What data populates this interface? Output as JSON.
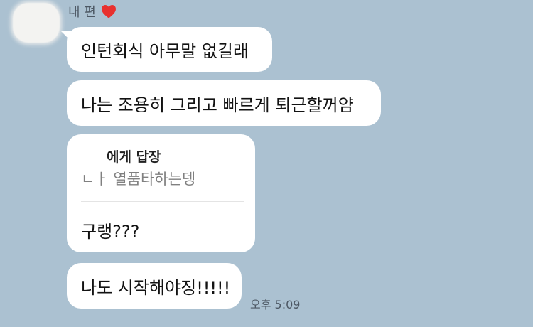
{
  "sender": {
    "name": "내 편",
    "badge_icon": "heart-icon",
    "badge_color": "#e8312f"
  },
  "messages": [
    {
      "text": "인턴회식 아무말 없길래"
    },
    {
      "text": "나는 조용히 그리고 빠르게 퇴근할꺼얌"
    },
    {
      "reply": {
        "to": "에게 답장",
        "quote": "ㄴㅏ 열품타하는뎅"
      },
      "text": "구랭???"
    },
    {
      "text": "나도 시작해야징!!!!!"
    }
  ],
  "timestamp": "오후 5:09",
  "colors": {
    "background": "#abc1d1",
    "bubble": "#ffffff"
  }
}
